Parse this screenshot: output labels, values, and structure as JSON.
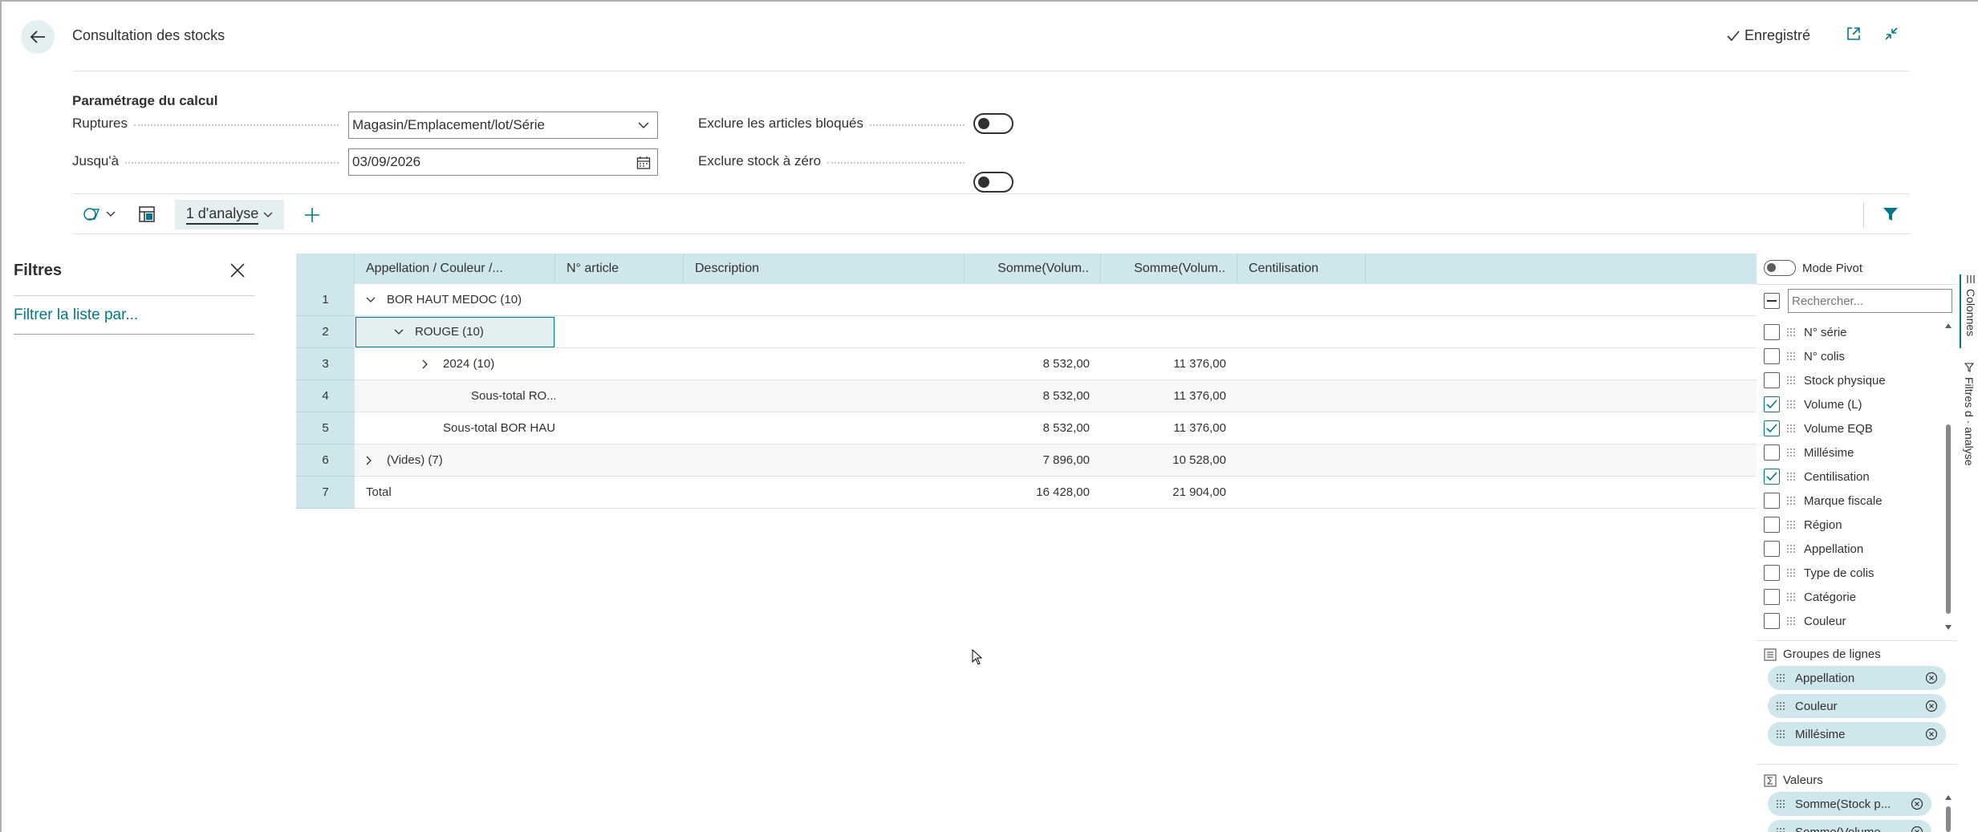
{
  "header": {
    "title": "Consultation des stocks",
    "saved_label": "Enregistré"
  },
  "params": {
    "section_title": "Paramétrage du calcul",
    "ruptures_label": "Ruptures",
    "ruptures_value": "Magasin/Emplacement/lot/Série",
    "jusqua_label": "Jusqu'à",
    "jusqua_value": "03/09/2026",
    "exclude_blocked_label": "Exclure les articles bloqués",
    "exclude_zero_label": "Exclure stock à zéro"
  },
  "toolbar": {
    "analysis_tab": "1 d'analyse"
  },
  "filters": {
    "title": "Filtres",
    "filter_link": "Filtrer la liste par..."
  },
  "grid": {
    "headers": [
      "Appellation / Couleur /...",
      "N° article",
      "Description",
      "Somme(Volum..",
      "Somme(Volum..",
      "Centilisation"
    ],
    "rows": [
      {
        "num": "1",
        "label": "BOR HAUT MEDOC (10)",
        "v1": "",
        "v2": ""
      },
      {
        "num": "2",
        "label": "ROUGE (10)",
        "v1": "",
        "v2": ""
      },
      {
        "num": "3",
        "label": "2024 (10)",
        "v1": "8 532,00",
        "v2": "11 376,00"
      },
      {
        "num": "4",
        "label": "Sous-total RO...",
        "v1": "8 532,00",
        "v2": "11 376,00"
      },
      {
        "num": "5",
        "label": "Sous-total BOR HAU...",
        "v1": "8 532,00",
        "v2": "11 376,00"
      },
      {
        "num": "6",
        "label": "(Vides) (7)",
        "v1": "7 896,00",
        "v2": "10 528,00"
      },
      {
        "num": "7",
        "label": "Total",
        "v1": "16 428,00",
        "v2": "21 904,00"
      }
    ]
  },
  "panel": {
    "pivot_label": "Mode Pivot",
    "search_placeholder": "Rechercher...",
    "columns": [
      {
        "label": "N° série",
        "checked": false
      },
      {
        "label": "N° colis",
        "checked": false
      },
      {
        "label": "Stock physique",
        "checked": false
      },
      {
        "label": "Volume (L)",
        "checked": true
      },
      {
        "label": "Volume EQB",
        "checked": true
      },
      {
        "label": "Millésime",
        "checked": false
      },
      {
        "label": "Centilisation",
        "checked": true
      },
      {
        "label": "Marque fiscale",
        "checked": false
      },
      {
        "label": "Région",
        "checked": false
      },
      {
        "label": "Appellation",
        "checked": false
      },
      {
        "label": "Type de colis",
        "checked": false
      },
      {
        "label": "Catégorie",
        "checked": false
      },
      {
        "label": "Couleur",
        "checked": false
      }
    ],
    "row_groups_title": "Groupes de lignes",
    "row_groups": [
      "Appellation",
      "Couleur",
      "Millésime"
    ],
    "values_title": "Valeurs",
    "values": [
      "Somme(Stock p...",
      "Somme(Volume..."
    ],
    "side_tab_columns": "Colonnes",
    "side_tab_filters": "Filtres d · analyse"
  },
  "colors": {
    "accent": "#00788a",
    "header_bg": "#cfe7ec"
  }
}
